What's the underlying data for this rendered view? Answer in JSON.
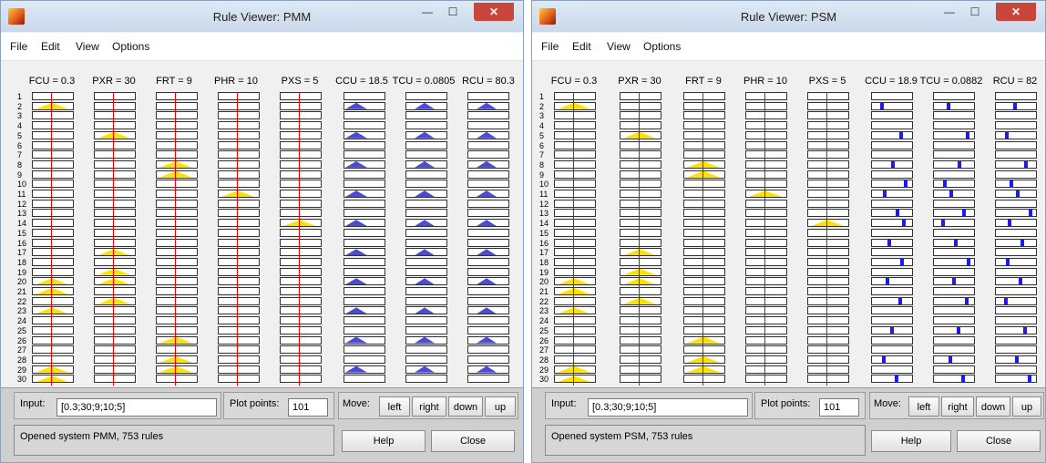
{
  "windows": [
    {
      "title": "Rule Viewer: PMM",
      "menu": [
        "File",
        "Edit",
        "View",
        "Options"
      ],
      "inputs": [
        {
          "label": "FCU = 0.3"
        },
        {
          "label": "PXR = 30"
        },
        {
          "label": "FRT = 9"
        },
        {
          "label": "PHR = 10"
        },
        {
          "label": "PXS = 5"
        }
      ],
      "outputs": [
        {
          "label": "CCU = 18.5"
        },
        {
          "label": "TCU = 0.0805"
        },
        {
          "label": "RCU = 80.3"
        }
      ],
      "rule_numbers": [
        "1",
        "2",
        "3",
        "4",
        "5",
        "6",
        "7",
        "8",
        "9",
        "10",
        "11",
        "12",
        "13",
        "14",
        "15",
        "16",
        "17",
        "18",
        "19",
        "20",
        "21",
        "22",
        "23",
        "24",
        "25",
        "26",
        "27",
        "28",
        "29",
        "30"
      ],
      "input_label": "Input:",
      "input_value": "[0.3;30;9;10;5]",
      "plot_points_label": "Plot points:",
      "plot_points_value": "101",
      "move_label": "Move:",
      "move_buttons": [
        "left",
        "right",
        "down",
        "up"
      ],
      "status": "Opened system PMM, 753 rules",
      "help_label": "Help",
      "close_label": "Close"
    },
    {
      "title": "Rule Viewer: PSM",
      "menu": [
        "File",
        "Edit",
        "View",
        "Options"
      ],
      "inputs": [
        {
          "label": "FCU = 0.3"
        },
        {
          "label": "PXR = 30"
        },
        {
          "label": "FRT = 9"
        },
        {
          "label": "PHR = 10"
        },
        {
          "label": "PXS = 5"
        }
      ],
      "outputs": [
        {
          "label": "CCU = 18.9"
        },
        {
          "label": "TCU = 0.0882"
        },
        {
          "label": "RCU = 82"
        }
      ],
      "rule_numbers": [
        "1",
        "2",
        "3",
        "4",
        "5",
        "6",
        "7",
        "8",
        "9",
        "10",
        "11",
        "12",
        "13",
        "14",
        "15",
        "16",
        "17",
        "18",
        "19",
        "20",
        "21",
        "22",
        "23",
        "24",
        "25",
        "26",
        "27",
        "28",
        "29",
        "30"
      ],
      "input_label": "Input:",
      "input_value": "[0.3;30;9;10;5]",
      "plot_points_label": "Plot points:",
      "plot_points_value": "101",
      "move_label": "Move:",
      "move_buttons": [
        "left",
        "right",
        "down",
        "up"
      ],
      "status": "Opened system PSM, 753 rules",
      "help_label": "Help",
      "close_label": "Close"
    }
  ],
  "colors": {
    "membership_fill": "#ffe000",
    "output_fill": "#4a4adb",
    "input_marker": "#ee0000",
    "close_button": "#c9463d"
  }
}
